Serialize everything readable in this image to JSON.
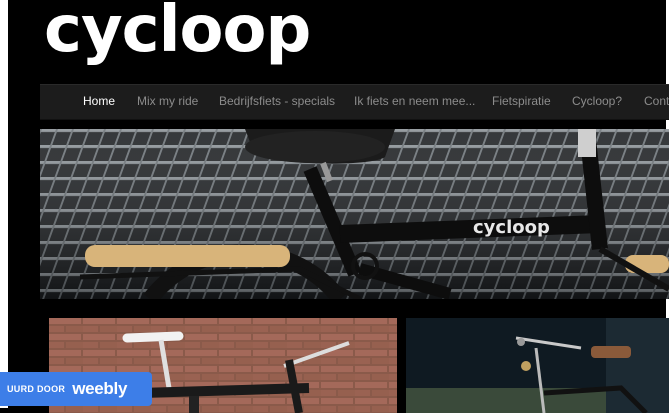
{
  "site": {
    "logo_text": "cycloop"
  },
  "nav": {
    "items": [
      {
        "label": "Home",
        "active": true
      },
      {
        "label": "Mix my ride"
      },
      {
        "label": "Bedrijfsfiets - specials"
      },
      {
        "label": "Ik fiets en neem mee..."
      },
      {
        "label": "Fietspiratie"
      },
      {
        "label": "Cycloop?"
      },
      {
        "label": "Conta"
      }
    ]
  },
  "hero": {
    "frame_brand": "cycloop"
  },
  "badge": {
    "prefix": "UURD DOOR",
    "brand": "weebly"
  },
  "colors": {
    "badge_blue": "#3d7ee8",
    "nav_bg": "#1c1c1c",
    "seat_wood": "#d8b47a",
    "page_bg": "#000000"
  }
}
